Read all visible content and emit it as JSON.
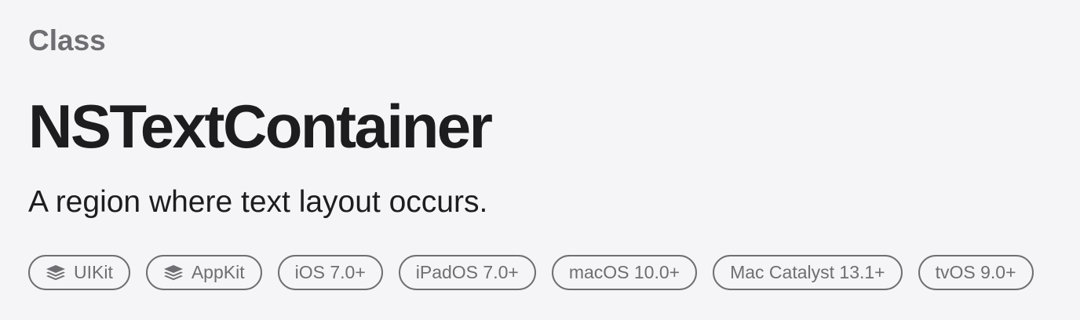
{
  "header": {
    "role": "Class",
    "title": "NSTextContainer",
    "abstract": "A region where text layout occurs."
  },
  "badges": [
    {
      "label": "UIKit",
      "icon": "framework-stack-icon"
    },
    {
      "label": "AppKit",
      "icon": "framework-stack-icon"
    },
    {
      "label": "iOS 7.0+"
    },
    {
      "label": "iPadOS 7.0+"
    },
    {
      "label": "macOS 10.0+"
    },
    {
      "label": "Mac Catalyst 13.1+"
    },
    {
      "label": "tvOS 9.0+"
    }
  ],
  "colors": {
    "background": "#f5f5f7",
    "text_primary": "#1d1d1f",
    "text_secondary": "#6e6e73"
  }
}
